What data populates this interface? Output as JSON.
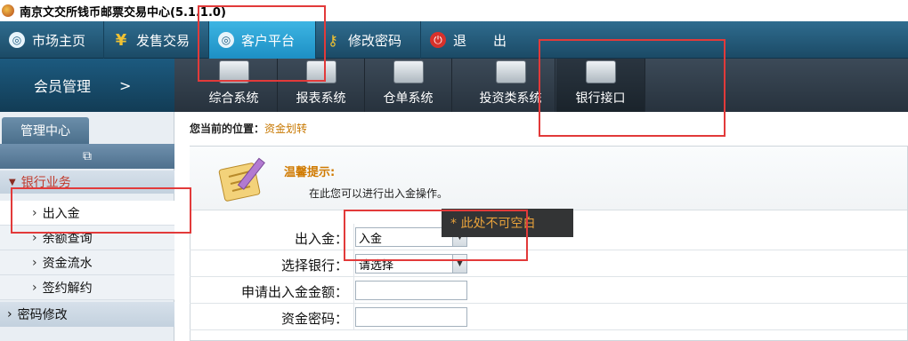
{
  "window": {
    "title": "南京文交所钱币邮票交易中心(5.1.1.0)"
  },
  "topnav": [
    {
      "label": "市场主页",
      "icon": "circle-logo-icon"
    },
    {
      "label": "发售交易",
      "icon": "yen-icon"
    },
    {
      "label": "客户平台",
      "icon": "circle-logo-icon",
      "active": true
    },
    {
      "label": "修改密码",
      "icon": "key-icon"
    },
    {
      "label": "退　　出",
      "icon": "power-icon"
    }
  ],
  "member": {
    "label": "会员管理",
    "arrow": ">"
  },
  "modules": [
    {
      "label": "综合系统"
    },
    {
      "label": "报表系统"
    },
    {
      "label": "仓单系统"
    },
    {
      "label": "投资类系统"
    },
    {
      "label": "银行接口",
      "active": true
    }
  ],
  "sidebar": {
    "tab": "管理中心",
    "group": "银行业务",
    "items": [
      "出入金",
      "余额查询",
      "资金流水",
      "签约解约"
    ],
    "selected": "出入金",
    "password": "密码修改"
  },
  "breadcrumb": {
    "prefix": "您当前的位置：",
    "current": "资金划转"
  },
  "tip": {
    "title": "温馨提示:",
    "text": "在此您可以进行出入金操作。"
  },
  "form": {
    "direction": {
      "label": "出入金：",
      "value": "入金"
    },
    "bank": {
      "label": "选择银行：",
      "value": "请选择"
    },
    "amount": {
      "label": "申请出入金金额：",
      "value": ""
    },
    "password": {
      "label": "资金密码：",
      "value": ""
    }
  },
  "tooltip": "* 此处不可空白",
  "colors": {
    "accent_tab": "#2aa3d8",
    "annotation": "#e23a3a",
    "tip_title": "#d07a00"
  }
}
